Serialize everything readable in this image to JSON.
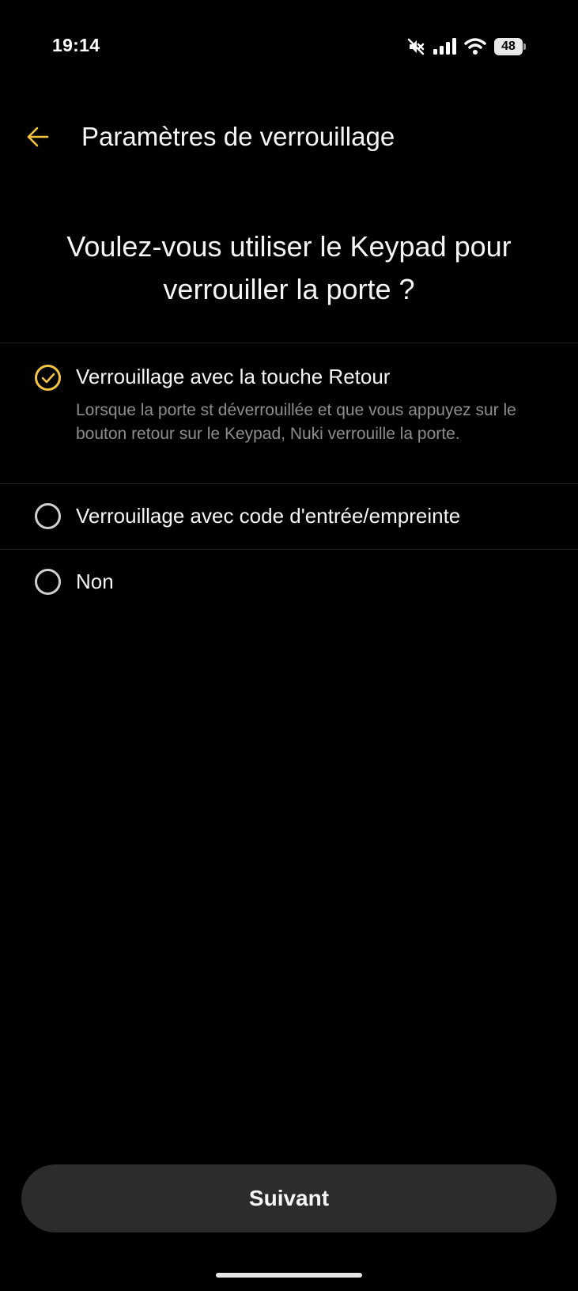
{
  "status_bar": {
    "time": "19:14",
    "battery": "48",
    "icons": [
      "mute-icon",
      "signal-icon",
      "wifi-icon",
      "battery-icon"
    ]
  },
  "app_bar": {
    "back_icon": "arrow-left-icon",
    "title": "Paramètres de verrouillage"
  },
  "question": {
    "line1": "Voulez-vous utiliser le Keypad pour",
    "line2": "verrouiller la porte ?"
  },
  "options": [
    {
      "label": "Verrouillage avec la touche Retour",
      "description": "Lorsque la porte st déverrouillée et que vous appuyez sur le bouton retour sur le Keypad, Nuki verrouille la porte.",
      "selected": true
    },
    {
      "label": "Verrouillage avec code d'entrée/empreinte",
      "selected": false
    },
    {
      "label": "Non",
      "selected": false
    }
  ],
  "next_button": {
    "label": "Suivant"
  },
  "colors": {
    "accent": "#f4c542",
    "background": "#000000",
    "button_bg": "#2c2c2c",
    "secondary_text": "#8e8e8e"
  }
}
